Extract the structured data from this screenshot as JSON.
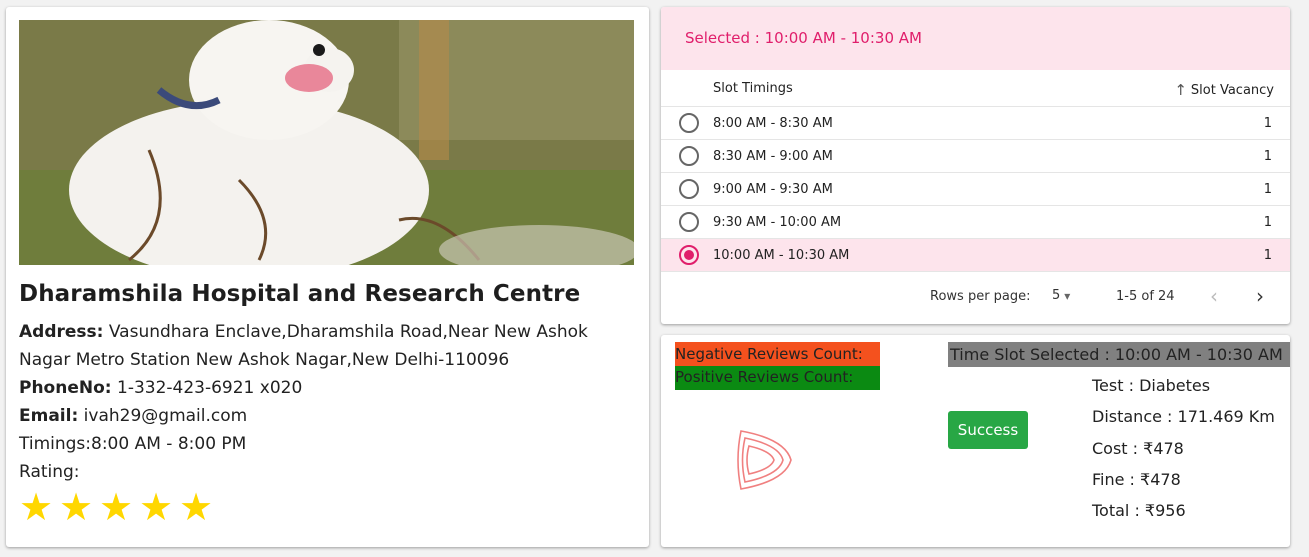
{
  "hospital": {
    "name": "Dharamshila Hospital and Research Centre",
    "address_label": "Address:",
    "address_value": " Vasundhara Enclave,Dharamshila Road,Near New Ashok Nagar Metro Station New Ashok Nagar,New Delhi-110096",
    "phone_label": "PhoneNo:",
    "phone_value": " 1-332-423-6921 x020",
    "email_label": "Email:",
    "email_value": " ivah29@gmail.com",
    "timings": "Timings:8:00 AM - 8:00 PM",
    "rating_label": "Rating:",
    "rating_value": 5,
    "stars": [
      "★",
      "★",
      "★",
      "★",
      "★"
    ]
  },
  "slots": {
    "selected_text": "Selected : 10:00 AM - 10:30 AM",
    "col_timings": "Slot Timings",
    "col_vacancy": "Slot Vacancy",
    "sort_icon": "↑",
    "rows": [
      {
        "time": "8:00 AM - 8:30 AM",
        "vacancy": "1",
        "selected": false
      },
      {
        "time": "8:30 AM - 9:00 AM",
        "vacancy": "1",
        "selected": false
      },
      {
        "time": "9:00 AM - 9:30 AM",
        "vacancy": "1",
        "selected": false
      },
      {
        "time": "9:30 AM - 10:00 AM",
        "vacancy": "1",
        "selected": false
      },
      {
        "time": "10:00 AM - 10:30 AM",
        "vacancy": "1",
        "selected": true
      }
    ],
    "rows_per_page_label": "Rows per page:",
    "rows_per_page_value": "5",
    "range_text": "1-5 of 24",
    "prev_glyph": "‹",
    "next_glyph": "›",
    "dropdown_glyph": "▾"
  },
  "summary": {
    "negative_label": "Negative Reviews Count:",
    "positive_label": "Positive Reviews Count:",
    "time_slot_selected": "Time Slot Selected : 10:00 AM - 10:30 AM",
    "success_button": "Success",
    "test": "Test : Diabetes",
    "distance": "Distance : 171.469 Km",
    "cost": "Cost : ₹478",
    "fine": "Fine : ₹478",
    "total": "Total : ₹956"
  },
  "colors": {
    "accent": "#e01e6b",
    "selected_bg": "#fde4ec",
    "negative": "#f4511e",
    "positive": "#0b8a12",
    "timeslot_bg": "#808080",
    "success": "#28a745",
    "star": "#ffd700"
  }
}
